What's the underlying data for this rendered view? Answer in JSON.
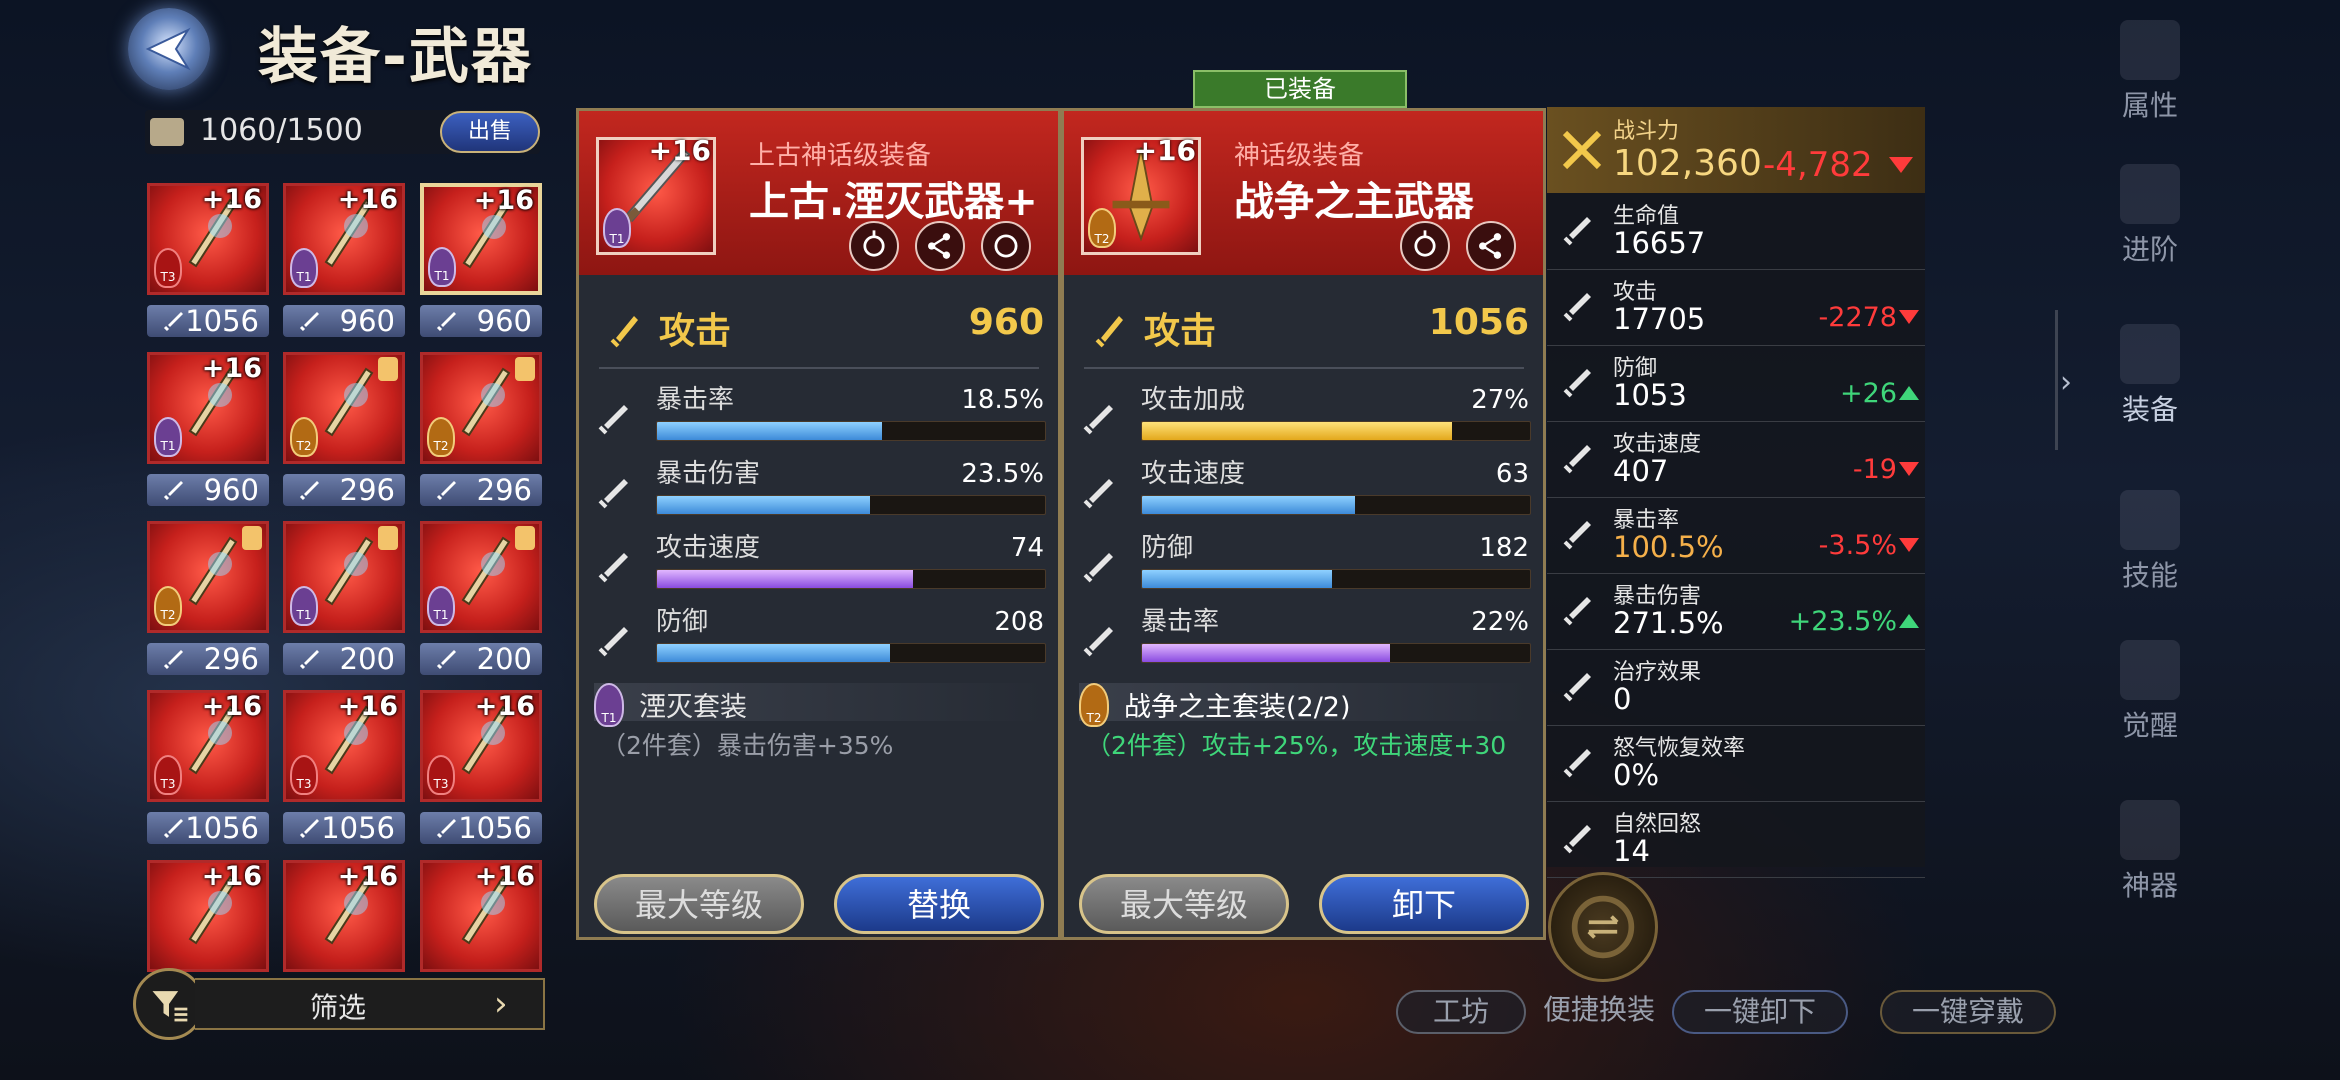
{
  "header": {
    "title": "装备-武器"
  },
  "inventory": {
    "capacity": "1060/1500",
    "sell_label": "出售",
    "filter_label": "筛选",
    "items": [
      {
        "level": "+16",
        "tier": "T3",
        "stat": "1056",
        "selected": false,
        "art": "hammer"
      },
      {
        "level": "+16",
        "tier": "T1",
        "stat": "960",
        "selected": false,
        "art": "scythe"
      },
      {
        "level": "+16",
        "tier": "T1",
        "stat": "960",
        "selected": true,
        "art": "sword"
      },
      {
        "level": "+16",
        "tier": "T1",
        "stat": "960",
        "selected": false,
        "art": "sword"
      },
      {
        "level": "",
        "tier": "T2",
        "stat": "296",
        "selected": false,
        "art": "shield"
      },
      {
        "level": "",
        "tier": "T2",
        "stat": "296",
        "selected": false,
        "art": "greatsword"
      },
      {
        "level": "",
        "tier": "T2",
        "stat": "296",
        "selected": false,
        "art": "greatsword"
      },
      {
        "level": "",
        "tier": "T1",
        "stat": "200",
        "selected": false,
        "art": "crystal"
      },
      {
        "level": "",
        "tier": "T1",
        "stat": "200",
        "selected": false,
        "art": "sword"
      },
      {
        "level": "+16",
        "tier": "T3",
        "stat": "1056",
        "selected": false,
        "art": "hammer"
      },
      {
        "level": "+16",
        "tier": "T3",
        "stat": "1056",
        "selected": false,
        "art": "mace"
      },
      {
        "level": "+16",
        "tier": "T3",
        "stat": "1056",
        "selected": false,
        "art": "mace"
      },
      {
        "level": "+16",
        "tier": "",
        "stat": "",
        "selected": false,
        "art": "mace"
      },
      {
        "level": "+16",
        "tier": "",
        "stat": "",
        "selected": false,
        "art": "mace"
      },
      {
        "level": "+16",
        "tier": "",
        "stat": "",
        "selected": false,
        "art": "greatsword"
      }
    ]
  },
  "left_panel": {
    "level": "+16",
    "tier": "T1",
    "type": "上古神话级装备",
    "name": "上古.湮灭武器+",
    "main_stat": {
      "label": "攻击",
      "value": "960"
    },
    "stats": [
      {
        "label": "暴击率",
        "value": "18.5%",
        "fill": 0.58,
        "color": "blue"
      },
      {
        "label": "暴击伤害",
        "value": "23.5%",
        "fill": 0.55,
        "color": "blue"
      },
      {
        "label": "攻击速度",
        "value": "74",
        "fill": 0.66,
        "color": "purple"
      },
      {
        "label": "防御",
        "value": "208",
        "fill": 0.6,
        "color": "blue"
      }
    ],
    "set": {
      "tier": "T1",
      "name": "湮灭套装",
      "desc": "（2件套）暴击伤害+35%"
    },
    "btn_max": "最大等级",
    "btn_action": "替换"
  },
  "right_panel": {
    "equipped_label": "已装备",
    "level": "+16",
    "tier": "T2",
    "type": "神话级装备",
    "name": "战争之主武器",
    "main_stat": {
      "label": "攻击",
      "value": "1056"
    },
    "stats": [
      {
        "label": "攻击加成",
        "value": "27%",
        "fill": 0.8,
        "color": "gold"
      },
      {
        "label": "攻击速度",
        "value": "63",
        "fill": 0.55,
        "color": "blue"
      },
      {
        "label": "防御",
        "value": "182",
        "fill": 0.49,
        "color": "blue"
      },
      {
        "label": "暴击率",
        "value": "22%",
        "fill": 0.64,
        "color": "purple"
      }
    ],
    "set": {
      "tier": "T2",
      "name": "战争之主套装(2/2)",
      "desc": "（2件套）攻击+25%，攻击速度+30"
    },
    "btn_max": "最大等级",
    "btn_action": "卸下"
  },
  "stats_panel": {
    "power": {
      "label": "战斗力",
      "value": "102,360",
      "diff": "-4,782"
    },
    "rows": [
      {
        "label": "生命值",
        "value": "16657",
        "diff": "",
        "trend": ""
      },
      {
        "label": "攻击",
        "value": "17705",
        "diff": "-2278",
        "trend": "down"
      },
      {
        "label": "防御",
        "value": "1053",
        "diff": "+26",
        "trend": "up"
      },
      {
        "label": "攻击速度",
        "value": "407",
        "diff": "-19",
        "trend": "down"
      },
      {
        "label": "暴击率",
        "value": "100.5%",
        "diff": "-3.5%",
        "trend": "down",
        "highlight": true
      },
      {
        "label": "暴击伤害",
        "value": "271.5%",
        "diff": "+23.5%",
        "trend": "up"
      },
      {
        "label": "治疗效果",
        "value": "0",
        "diff": "",
        "trend": ""
      },
      {
        "label": "怒气恢复效率",
        "value": "0%",
        "diff": "",
        "trend": ""
      },
      {
        "label": "自然回怒",
        "value": "14",
        "diff": "",
        "trend": ""
      }
    ]
  },
  "side_nav": [
    {
      "label": "属性"
    },
    {
      "label": "进阶"
    },
    {
      "label": "装备",
      "active": true
    },
    {
      "label": "技能"
    },
    {
      "label": "觉醒"
    },
    {
      "label": "神器"
    }
  ],
  "bottom": {
    "workshop": "工坊",
    "quick_swap": "便捷换装",
    "unequip_all": "一键卸下",
    "equip_all": "一键穿戴"
  },
  "colors": {
    "accent_red": "#c2271f",
    "gold": "#f2c84b",
    "up": "#3fd67a",
    "down": "#ff3b3b"
  }
}
